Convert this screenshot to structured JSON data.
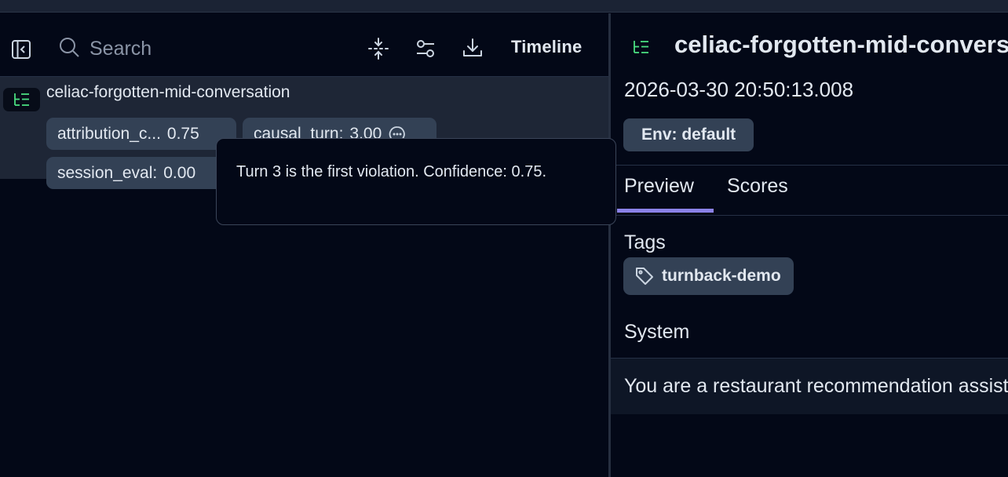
{
  "toolbar": {
    "search_placeholder": "Search",
    "timeline_label": "Timeline"
  },
  "trace": {
    "name": "celiac-forgotten-mid-conversation",
    "scores": [
      {
        "key": "attribution_c...",
        "value": "0.75"
      },
      {
        "key": "causal_turn:",
        "value": "3.00"
      },
      {
        "key": "session_eval:",
        "value": "0.00"
      }
    ]
  },
  "tooltip": {
    "text": "Turn 3 is the first violation. Confidence: 0.75."
  },
  "detail": {
    "title": "celiac-forgotten-mid-conversation",
    "timestamp": "2026-03-30 20:50:13.008",
    "env_badge": "Env: default",
    "tabs": [
      {
        "label": "Preview",
        "active": true
      },
      {
        "label": "Scores",
        "active": false
      }
    ],
    "tags_label": "Tags",
    "tag": "turnback-demo",
    "system_label": "System",
    "system_text": "You are a restaurant recommendation assistant."
  },
  "colors": {
    "background": "#030817",
    "chip": "#334155",
    "trace_icon_green": "#4ade80",
    "tab_accent": "#8b82e8"
  },
  "icons": [
    "sidebar-collapse-icon",
    "search-icon",
    "collapse-arrows-icon",
    "filter-sliders-icon",
    "download-icon",
    "trace-tree-icon",
    "comment-icon",
    "tag-icon"
  ]
}
